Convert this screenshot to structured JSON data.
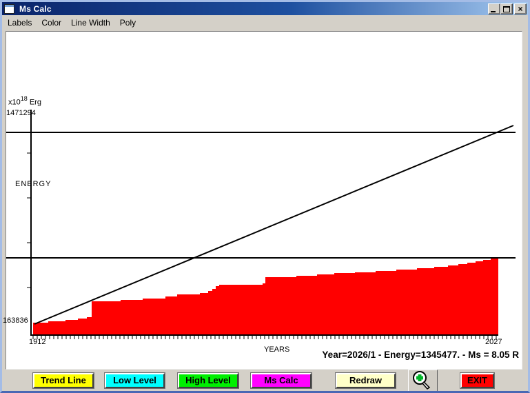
{
  "window": {
    "title": "Ms Calc",
    "controls": {
      "minimize": "",
      "maximize": "",
      "close": "×"
    }
  },
  "menu": {
    "items": [
      {
        "label": "Labels"
      },
      {
        "label": "Color"
      },
      {
        "label": "Line Width"
      },
      {
        "label": "Poly"
      }
    ]
  },
  "chart_data": {
    "type": "area",
    "title": "",
    "xlabel": "YEARS",
    "ylabel": "ENERGY",
    "y_unit": {
      "prefix": "x10",
      "exponent": "18",
      "suffix": " Erg"
    },
    "y_top_value": "1471294",
    "y_bottom_value": "163836",
    "x_start_label": "1912",
    "x_end_label": "2027",
    "x_range": [
      1912,
      2027
    ],
    "y_range_x10e18_erg": [
      163836,
      1471294
    ],
    "series": [
      {
        "name": "cumulative-energy-release",
        "type": "staircase-area",
        "color": "#ff0000",
        "start": {
          "year": 1912,
          "value": 163836
        },
        "end": {
          "year": "2026/1",
          "value": 1345477
        }
      },
      {
        "name": "trend-line",
        "type": "line",
        "from_year": 1912,
        "to_year": 2027
      },
      {
        "name": "high-level",
        "type": "hline",
        "estimated_value_x10e18_erg": 1350000
      },
      {
        "name": "low-level",
        "type": "hline",
        "estimated_value_x10e18_erg": 560000
      }
    ],
    "legend": "none",
    "grid": false,
    "colors": {
      "area": "#ff0000",
      "lines": "#000000"
    },
    "render": {
      "lines": [
        [
          36,
          113,
          36,
          441,
          2
        ],
        [
          35,
          440,
          714,
          440,
          2
        ],
        [
          0,
          146,
          739,
          146,
          2
        ],
        [
          0,
          328,
          739,
          328,
          2
        ],
        [
          41,
          424,
          736,
          136,
          2
        ]
      ],
      "x_ticks": {
        "x0": 39,
        "x1": 714,
        "step": 6,
        "y": 441,
        "len": 5
      },
      "y_ticks": {
        "ys": [
          176,
          241,
          306,
          371
        ],
        "x": 30,
        "len": 6
      },
      "area_points": [
        [
          39,
          439
        ],
        [
          39,
          422
        ],
        [
          61,
          422
        ],
        [
          61,
          420
        ],
        [
          86,
          420
        ],
        [
          86,
          418
        ],
        [
          104,
          418
        ],
        [
          104,
          416
        ],
        [
          117,
          416
        ],
        [
          117,
          414
        ],
        [
          124,
          414
        ],
        [
          124,
          391
        ],
        [
          166,
          391
        ],
        [
          166,
          389
        ],
        [
          198,
          389
        ],
        [
          198,
          387
        ],
        [
          231,
          387
        ],
        [
          231,
          384
        ],
        [
          248,
          384
        ],
        [
          248,
          381
        ],
        [
          281,
          381
        ],
        [
          281,
          379
        ],
        [
          293,
          379
        ],
        [
          293,
          376
        ],
        [
          299,
          376
        ],
        [
          299,
          373
        ],
        [
          304,
          373
        ],
        [
          304,
          369
        ],
        [
          309,
          369
        ],
        [
          309,
          367
        ],
        [
          372,
          367
        ],
        [
          372,
          365
        ],
        [
          376,
          365
        ],
        [
          376,
          356
        ],
        [
          421,
          356
        ],
        [
          421,
          354
        ],
        [
          451,
          354
        ],
        [
          451,
          352
        ],
        [
          476,
          352
        ],
        [
          476,
          350
        ],
        [
          506,
          350
        ],
        [
          506,
          349
        ],
        [
          536,
          349
        ],
        [
          536,
          347
        ],
        [
          566,
          347
        ],
        [
          566,
          345
        ],
        [
          596,
          345
        ],
        [
          596,
          343
        ],
        [
          621,
          343
        ],
        [
          621,
          341
        ],
        [
          641,
          341
        ],
        [
          641,
          339
        ],
        [
          656,
          339
        ],
        [
          656,
          337
        ],
        [
          669,
          337
        ],
        [
          669,
          335
        ],
        [
          681,
          335
        ],
        [
          681,
          333
        ],
        [
          692,
          333
        ],
        [
          692,
          331
        ],
        [
          703,
          331
        ],
        [
          703,
          329
        ],
        [
          714,
          329
        ],
        [
          714,
          439
        ]
      ]
    }
  },
  "status_text": "Year=2026/1 - Energy=1345477. - Ms = 8.05 R",
  "buttons": [
    {
      "label": "Trend Line",
      "bg": "#ffff00"
    },
    {
      "label": "Low Level",
      "bg": "#00ffff"
    },
    {
      "label": "High Level",
      "bg": "#00f000"
    },
    {
      "label": "Ms Calc",
      "bg": "#ff00ff"
    },
    {
      "label": "Redraw",
      "bg": "#ffffc8"
    },
    {
      "label": "EXIT",
      "bg": "#ff0000"
    }
  ],
  "zoom_tool": {
    "icon": "magnifier-plus",
    "plus_color": "#00b428"
  }
}
